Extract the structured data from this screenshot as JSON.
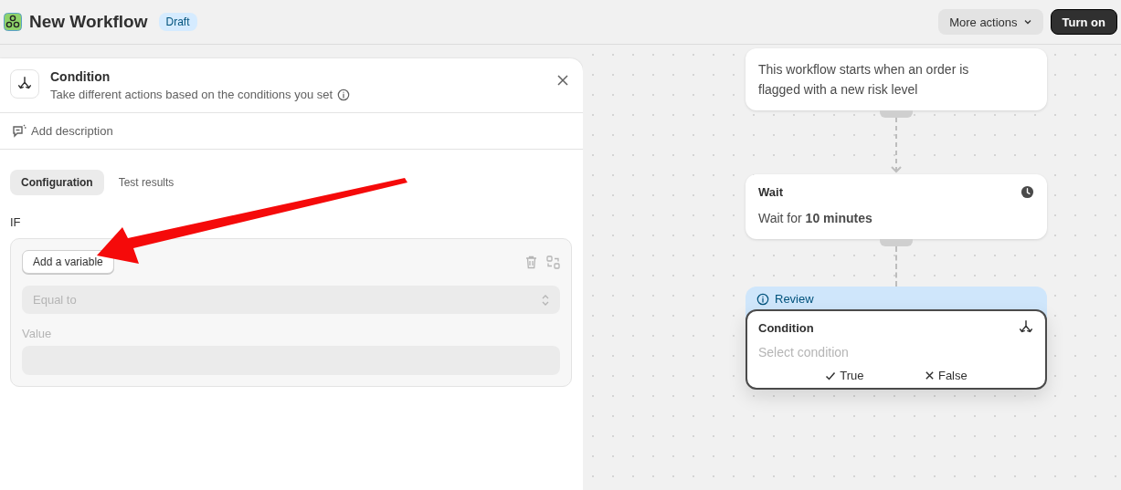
{
  "header": {
    "title": "New Workflow",
    "badge": "Draft",
    "buttons": [
      {
        "label": "More actions",
        "kind": "menu"
      },
      {
        "label": "Turn on",
        "kind": "primary"
      }
    ]
  },
  "panel": {
    "title": "Condition",
    "subtitle": "Take different actions based on the conditions you set",
    "description_action": "Add description",
    "tabs": [
      {
        "label": "Configuration",
        "selected": true
      },
      {
        "label": "Test results",
        "selected": false
      }
    ],
    "section_label": "IF",
    "rule": {
      "variable_button": "Add a variable",
      "operator": {
        "value": "Equal to",
        "disabled": true
      },
      "value_label": "Value"
    }
  },
  "canvas": {
    "nodes": [
      {
        "kind": "trigger",
        "body": "This workflow starts when an order is flagged with a new risk level"
      },
      {
        "kind": "wait",
        "title": "Wait",
        "body": "Wait for **10 minutes**"
      },
      {
        "kind": "condition",
        "banner": "Review",
        "title": "Condition",
        "placeholder": "Select condition",
        "branches": [
          "True",
          "False"
        ]
      }
    ]
  }
}
